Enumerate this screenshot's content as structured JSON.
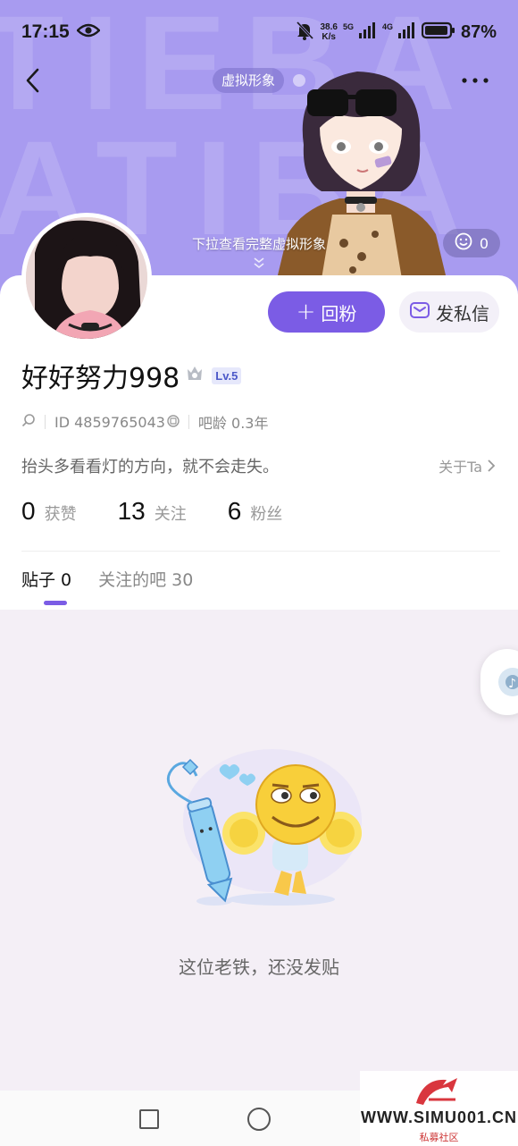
{
  "status_bar": {
    "time": "17:15",
    "net_speed_value": "38.6",
    "net_speed_unit": "K/s",
    "sim1_tag": "5G",
    "sim2_tag": "4G",
    "battery": "87%"
  },
  "header": {
    "avatar_tag": "虚拟形象",
    "pull_hint": "下拉查看完整虚拟形象",
    "like_count": "0",
    "accent_color": "#a89bf0",
    "bg_letters_line1": "TIEBA",
    "bg_letters_line2": "ATIBA"
  },
  "profile": {
    "follow_back_label": "回粉",
    "message_label": "发私信",
    "username": "好好努力998",
    "level": "Lv.5",
    "id_text": "ID 4859765043",
    "bar_age": "吧龄 0.3年",
    "bio": "抬头多看看灯的方向，就不会走失。",
    "about_label": "关于Ta"
  },
  "stats": [
    {
      "num": "0",
      "label": "获赞"
    },
    {
      "num": "13",
      "label": "关注"
    },
    {
      "num": "6",
      "label": "粉丝"
    }
  ],
  "tabs": [
    {
      "label": "贴子 0",
      "active": true
    },
    {
      "label": "关注的吧 30",
      "active": false
    }
  ],
  "empty_state": {
    "text": "这位老铁，还没发贴"
  },
  "watermark": {
    "text": "WWW.SIMU001.CN",
    "sub": "私募社区"
  },
  "colors": {
    "primary": "#7b5ce5",
    "page_bg": "#f4eff6"
  }
}
